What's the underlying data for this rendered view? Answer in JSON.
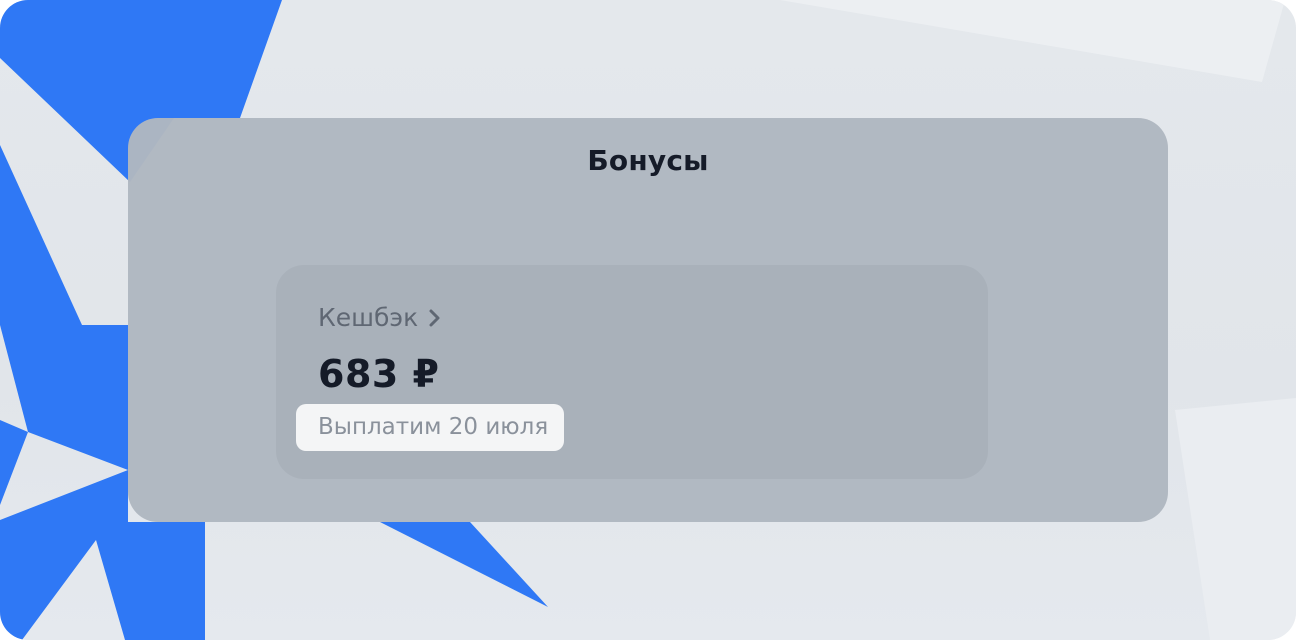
{
  "panel": {
    "title": "Бонусы"
  },
  "cashback": {
    "label": "Кешбэк",
    "chevron_icon": "chevron-right-icon",
    "amount": "683 ₽",
    "payout_note": "Выплатим 20 июля"
  },
  "colors": {
    "accent_star": "#2f78f5",
    "background": "#e2e6eb",
    "panel": "#b0b7c0",
    "card": "#a9b1ba",
    "badge": "#f4f5f6",
    "title_text": "#151b28"
  }
}
